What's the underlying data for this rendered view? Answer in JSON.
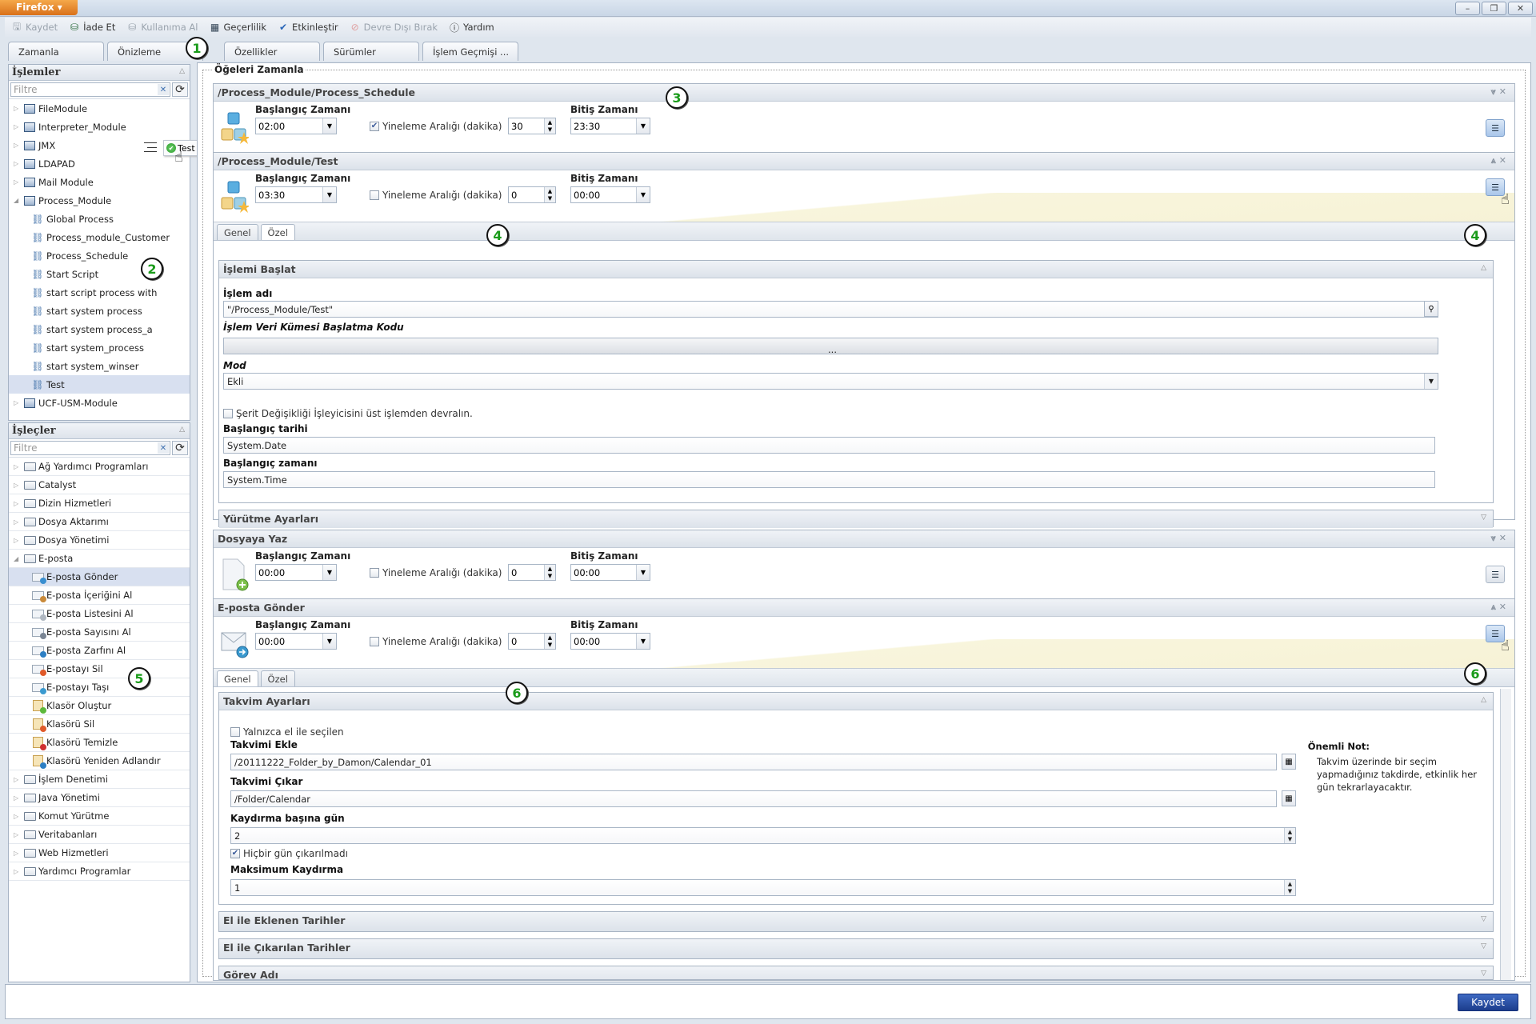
{
  "window": {
    "app_button": "Firefox ▾",
    "controls": {
      "minimize": "–",
      "restore": "❐",
      "close": "✕"
    }
  },
  "toolbar": {
    "items": [
      {
        "label": "Kaydet",
        "icon": "save-icon",
        "disabled": true
      },
      {
        "label": "İade Et",
        "icon": "checkin-icon",
        "disabled": false
      },
      {
        "label": "Kullanıma Al",
        "icon": "checkout-icon",
        "disabled": true
      },
      {
        "label": "Geçerlilik",
        "icon": "calendar-icon",
        "disabled": false
      },
      {
        "label": "Etkinleştir",
        "icon": "enable-check-icon",
        "disabled": false
      },
      {
        "label": "Devre Dışı Bırak",
        "icon": "disable-icon",
        "disabled": true
      },
      {
        "label": "Yardım",
        "icon": "help-icon",
        "disabled": false
      }
    ]
  },
  "tabs": [
    {
      "label": "Zamanla"
    },
    {
      "label": "Önizleme"
    },
    {
      "label": "Özellikler"
    },
    {
      "label": "Sürümler"
    },
    {
      "label": "İşlem Geçmişi ..."
    }
  ],
  "callouts": [
    "1",
    "2",
    "3",
    "4",
    "4",
    "5",
    "6",
    "6"
  ],
  "processes_pane": {
    "title": "İşlemler",
    "filter_placeholder": "Filtre",
    "items": [
      {
        "label": "FileModule",
        "type": "module",
        "expanded": false
      },
      {
        "label": "Interpreter_Module",
        "type": "module",
        "expanded": false
      },
      {
        "label": "JMX",
        "type": "module",
        "expanded": false
      },
      {
        "label": "LDAPAD",
        "type": "module",
        "expanded": false
      },
      {
        "label": "Mail Module",
        "type": "module",
        "expanded": false
      },
      {
        "label": "Process_Module",
        "type": "module",
        "expanded": true
      },
      {
        "label": "Global Process",
        "type": "process"
      },
      {
        "label": "Process_module_Customer",
        "type": "process"
      },
      {
        "label": "Process_Schedule",
        "type": "process"
      },
      {
        "label": "Start Script",
        "type": "process"
      },
      {
        "label": "start script process with",
        "type": "process"
      },
      {
        "label": "start system process",
        "type": "process"
      },
      {
        "label": "start system process_a",
        "type": "process"
      },
      {
        "label": "start system_process",
        "type": "process"
      },
      {
        "label": "start system_winser",
        "type": "process"
      },
      {
        "label": "Test",
        "type": "process",
        "selected": true
      },
      {
        "label": "UCF-USM-Module",
        "type": "module",
        "expanded": false
      }
    ],
    "drag_tooltip": "Test"
  },
  "operators_pane": {
    "title": "İşleçler",
    "filter_placeholder": "Filtre",
    "items": [
      {
        "label": "Ağ Yardımcı Programları",
        "type": "folder"
      },
      {
        "label": "Catalyst",
        "type": "folder"
      },
      {
        "label": "Dizin Hizmetleri",
        "type": "folder"
      },
      {
        "label": "Dosya Aktarımı",
        "type": "folder"
      },
      {
        "label": "Dosya Yönetimi",
        "type": "folder"
      },
      {
        "label": "E-posta",
        "type": "folder-open"
      },
      {
        "label": "E-posta Gönder",
        "type": "mail",
        "badge": "#3a8fd0",
        "selected": true
      },
      {
        "label": "E-posta İçeriğini Al",
        "type": "mail",
        "badge": "#c98a3a"
      },
      {
        "label": "E-posta Listesini Al",
        "type": "mail",
        "badge": "#b0b8c2"
      },
      {
        "label": "E-posta Sayısını Al",
        "type": "mail",
        "badge": "#7a8594"
      },
      {
        "label": "E-posta Zarfını Al",
        "type": "mail",
        "badge": "#2d7fc4"
      },
      {
        "label": "E-postayı Sil",
        "type": "mail",
        "badge": "#e05a2a"
      },
      {
        "label": "E-postayı Taşı",
        "type": "mail",
        "badge": "#3a9ad0"
      },
      {
        "label": "Klasör Oluştur",
        "type": "klasor",
        "badge": "#5cb83a"
      },
      {
        "label": "Klasörü Sil",
        "type": "klasor",
        "badge": "#e05a2a"
      },
      {
        "label": "Klasörü Temizle",
        "type": "klasor",
        "badge": "#d03030"
      },
      {
        "label": "Klasörü Yeniden Adlandır",
        "type": "klasor",
        "badge": "#2d7fc4"
      },
      {
        "label": "İşlem Denetimi",
        "type": "folder"
      },
      {
        "label": "Java Yönetimi",
        "type": "folder"
      },
      {
        "label": "Komut Yürütme",
        "type": "folder"
      },
      {
        "label": "Veritabanları",
        "type": "folder"
      },
      {
        "label": "Web Hizmetleri",
        "type": "folder"
      },
      {
        "label": "Yardımcı Programlar",
        "type": "folder"
      }
    ]
  },
  "main": {
    "fieldset_legend": "Öğeleri Zamanla",
    "labels": {
      "start_time": "Başlangıç Zamanı",
      "repeat_interval": "Yineleme Aralığı (dakika)",
      "end_time": "Bitiş Zamanı"
    },
    "cards": [
      {
        "title": "/Process_Module/Process_Schedule",
        "start": "02:00",
        "repeat_checked": true,
        "interval": "30",
        "end": "23:30"
      },
      {
        "title": "/Process_Module/Test",
        "start": "03:30",
        "repeat_checked": false,
        "interval": "0",
        "end": "00:00"
      },
      {
        "title": "Dosyaya Yaz",
        "start": "00:00",
        "repeat_checked": false,
        "interval": "0",
        "end": "00:00"
      },
      {
        "title": "E-posta Gönder",
        "start": "00:00",
        "repeat_checked": false,
        "interval": "0",
        "end": "00:00"
      }
    ],
    "subtabs": {
      "general": "Genel",
      "custom": "Özel"
    },
    "test_custom": {
      "section_title": "İşlemi Başlat",
      "process_name_label": "İşlem adı",
      "process_name_value": "\"/Process_Module/Test\"",
      "dataset_label": "İşlem Veri Kümesi Başlatma Kodu",
      "dataset_button": "...",
      "mode_label": "Mod",
      "mode_value": "Ekli",
      "inherit_label": "Şerit Değişikliği İşleyicisini üst işlemden devralın.",
      "inherit_checked": false,
      "start_date_label": "Başlangıç tarihi",
      "start_date_value": "System.Date",
      "start_time_label": "Başlangıç zamanı",
      "start_time_value": "System.Time",
      "exec_section": "Yürütme Ayarları"
    },
    "email_general": {
      "section_title": "Takvim Ayarları",
      "manual_only_label": "Yalnızca el ile seçilen",
      "manual_only_checked": false,
      "add_cal_label": "Takvimi Ekle",
      "add_cal_value": "/20111222_Folder_by_Damon/Calendar_01",
      "remove_cal_label": "Takvimi Çıkar",
      "remove_cal_value": "/Folder/Calendar",
      "days_per_shift_label": "Kaydırma başına gün",
      "days_per_shift_value": "2",
      "no_day_removed_label": "Hiçbir gün çıkarılmadı",
      "no_day_removed_checked": true,
      "max_shift_label": "Maksimum Kaydırma",
      "max_shift_value": "1",
      "note_title": "Önemli Not:",
      "note_text": "Takvim üzerinde bir seçim yapmadığınız takdirde, etkinlik her gün tekrarlayacaktır.",
      "sections_collapsed": [
        "El ile Eklenen Tarihler",
        "El ile Çıkarılan Tarihler",
        "Görev Adı"
      ]
    }
  },
  "footer": {
    "save_label": "Kaydet"
  }
}
